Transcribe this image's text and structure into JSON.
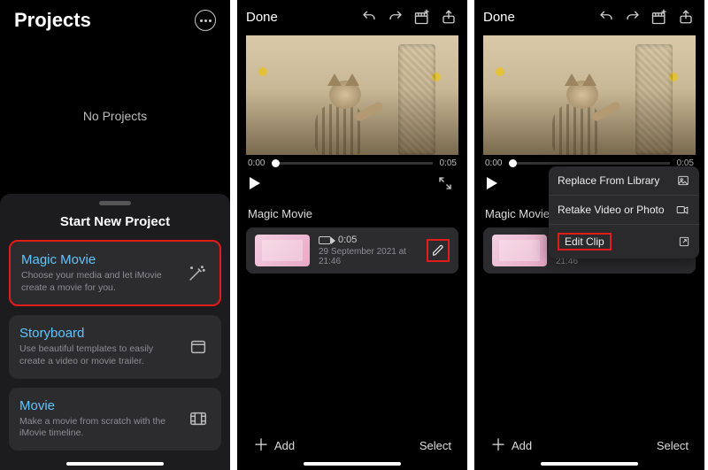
{
  "phone1": {
    "title": "Projects",
    "empty": "No Projects",
    "sheet_title": "Start New Project",
    "cards": [
      {
        "title": "Magic Movie",
        "desc": "Choose your media and let iMovie create a movie for you."
      },
      {
        "title": "Storyboard",
        "desc": "Use beautiful templates to easily create a video or movie trailer."
      },
      {
        "title": "Movie",
        "desc": "Make a movie from scratch with the iMovie timeline."
      }
    ]
  },
  "editor": {
    "done": "Done",
    "time_start": "0:00",
    "time_end": "0:05",
    "section_title": "Magic Movie",
    "clip_duration": "0:05",
    "clip_date": "29 September 2021 at 21:46",
    "add_label": "Add",
    "select_label": "Select"
  },
  "context_menu": {
    "items": [
      {
        "label": "Replace From Library"
      },
      {
        "label": "Retake Video or Photo"
      },
      {
        "label": "Edit Clip"
      }
    ]
  }
}
